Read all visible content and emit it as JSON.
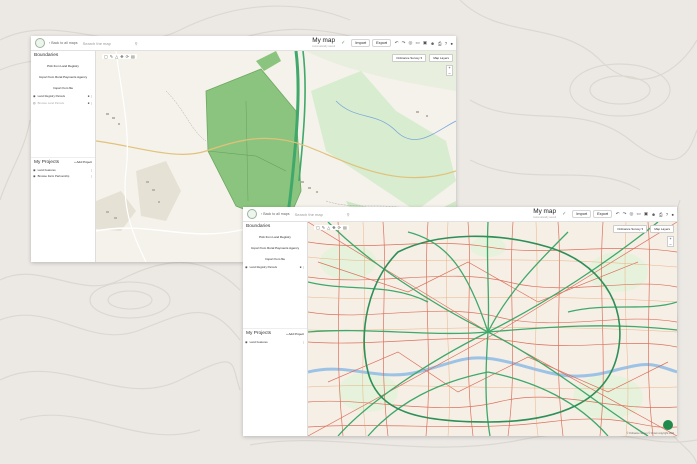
{
  "colors": {
    "background": "#ece9e5",
    "accent": "#1f8a4c",
    "field_green": "#8bc47e",
    "road_green": "#3fa86a",
    "road_red": "#d9644f"
  },
  "topbar": {
    "back_link": "Back to all maps",
    "search_placeholder": "Search the map",
    "title": "My map",
    "subtitle": "Automatically saved",
    "import_label": "Import",
    "export_label": "Export"
  },
  "sidebar": {
    "boundaries_title": "Boundaries",
    "buttons": [
      "Pick from Land Registry",
      "Import from Rural Payments Agency",
      "Import from file"
    ],
    "projects_title": "My Projects",
    "add_project_label": "Add Project"
  },
  "screen1": {
    "layers": [
      "Land Registry Parcels",
      "Browse Land Parcels"
    ],
    "projects": [
      "Land Features",
      "Browse Farm Partnership"
    ],
    "basemap_label": "Ordnance Survey",
    "layers_button": "Map Layers"
  },
  "screen2": {
    "layers": [
      "Land Registry Parcels"
    ],
    "projects": [
      "Land Features"
    ],
    "basemap_label": "Ordnance Survey",
    "layers_button": "Map Layers",
    "attribution": "© Ordnance Survey © Crown copyright 2024"
  }
}
